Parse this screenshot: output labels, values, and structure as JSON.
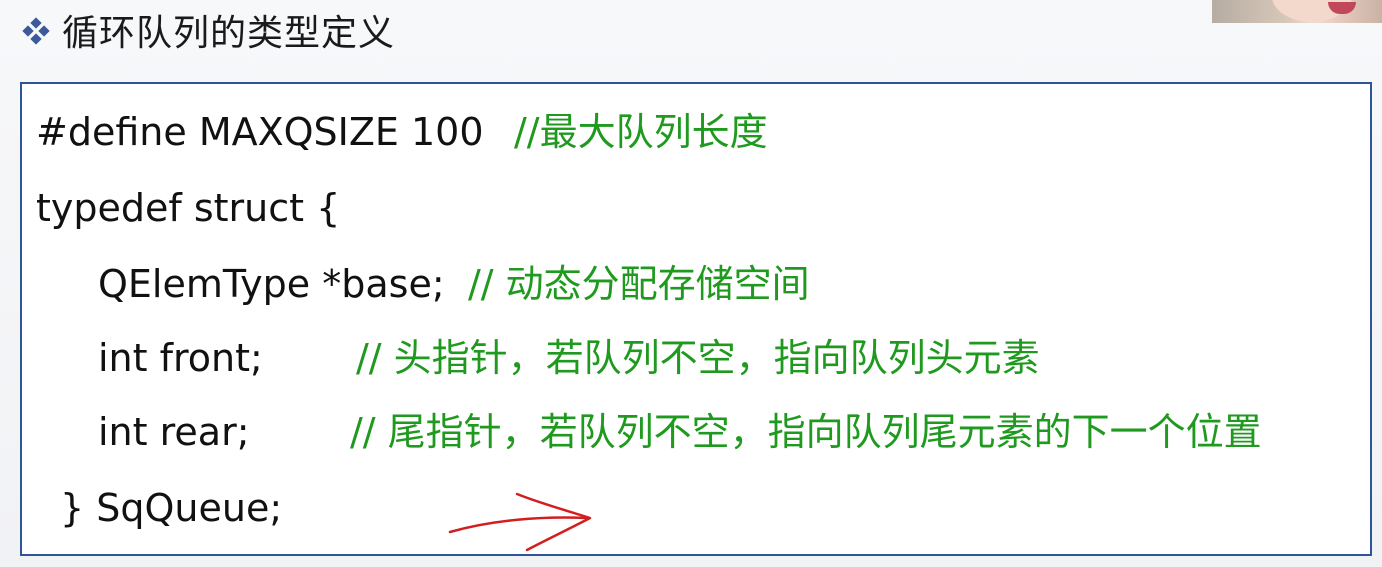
{
  "title": "循环队列的类型定义",
  "code": {
    "line1": {
      "code": "#define MAXQSIZE 100",
      "comment": "//最大队列长度"
    },
    "line2": {
      "code": "typedef struct {"
    },
    "line3": {
      "code": "QElemType *base;",
      "comment": "// 动态分配存储空间"
    },
    "line4": {
      "code": "int front;",
      "comment": "// 头指针，若队列不空，指向队列头元素"
    },
    "line5": {
      "code": "int rear;",
      "comment": "// 尾指针，若队列不空，指向队列尾元素的下一个位置"
    },
    "line6": {
      "code": "} SqQueue;"
    }
  },
  "colors": {
    "comment": "#1f9a1f",
    "border": "#2f5597",
    "annotation": "#d21e1e"
  }
}
